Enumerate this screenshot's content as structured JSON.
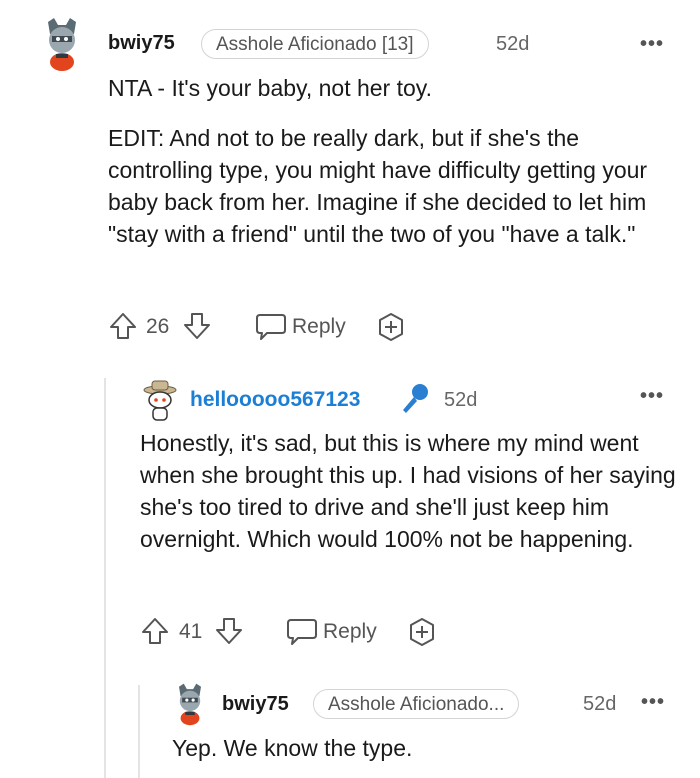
{
  "comments": [
    {
      "username": "bwiy75",
      "flair": "Asshole Aficionado [13]",
      "age": "52d",
      "more": "•••",
      "paragraphs": [
        "NTA - It's your baby, not her toy.",
        "EDIT: And not to be really dark, but if she's the controlling type, you might have difficulty getting your baby back from her. Imagine if she decided to let him \"stay with a friend\" until the two of you \"have a talk.\""
      ],
      "votes": "26",
      "reply_label": "Reply"
    },
    {
      "username": "hellooooo567123",
      "age": "52d",
      "more": "•••",
      "paragraphs": [
        "Honestly, it's sad, but this is where my mind went when she brought this up. I had visions of her saying she's too tired to drive and she'll just keep him overnight. Which would 100% not be happening."
      ],
      "votes": "41",
      "reply_label": "Reply"
    },
    {
      "username": "bwiy75",
      "flair": "Asshole Aficionado...",
      "age": "52d",
      "more": "•••",
      "paragraphs": [
        "Yep. We know the type."
      ]
    }
  ],
  "colors": {
    "username_accent": "#1b7fd6",
    "mic_icon": "#2a7fd3",
    "thread_line": "#e4e4e4"
  }
}
